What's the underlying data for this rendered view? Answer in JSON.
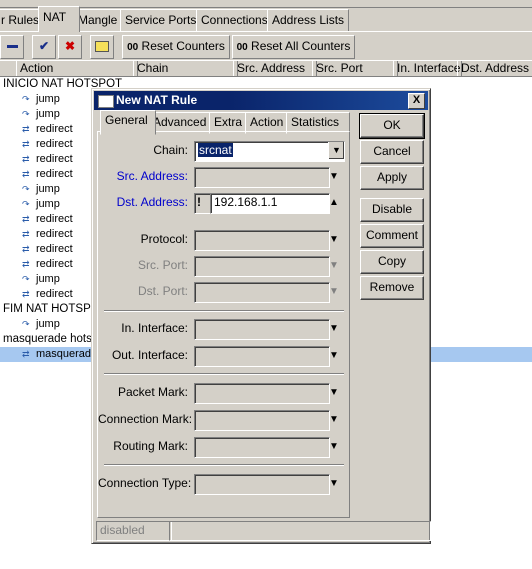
{
  "tabs": [
    "r Rules",
    "NAT",
    "Mangle",
    "Service Ports",
    "Connections",
    "Address Lists"
  ],
  "toolbar": {
    "reset_counters": "Reset Counters",
    "reset_all_counters": "Reset All Counters",
    "counter_icon": "00"
  },
  "columns": [
    "Action",
    "Chain",
    "Src. Address",
    "Src. Port",
    "In. Interface",
    "Dst. Address"
  ],
  "rows": [
    {
      "text": "INICIO NAT HOTSPOT",
      "kind": "comment"
    },
    {
      "text": "jump",
      "kind": "jump"
    },
    {
      "text": "jump",
      "kind": "jump"
    },
    {
      "text": "redirect",
      "kind": "redirect"
    },
    {
      "text": "redirect",
      "kind": "redirect"
    },
    {
      "text": "redirect",
      "kind": "redirect"
    },
    {
      "text": "redirect",
      "kind": "redirect"
    },
    {
      "text": "jump",
      "kind": "jump"
    },
    {
      "text": "jump",
      "kind": "jump"
    },
    {
      "text": "redirect",
      "kind": "redirect"
    },
    {
      "text": "redirect",
      "kind": "redirect"
    },
    {
      "text": "redirect",
      "kind": "redirect"
    },
    {
      "text": "redirect",
      "kind": "redirect"
    },
    {
      "text": "jump",
      "kind": "jump"
    },
    {
      "text": "redirect",
      "kind": "redirect"
    },
    {
      "text": "FIM NAT HOTSPO",
      "kind": "comment"
    },
    {
      "text": "jump",
      "kind": "jump"
    },
    {
      "text": "masquerade hotsp",
      "kind": "comment"
    },
    {
      "text": "masquerade",
      "kind": "redirect",
      "selected": true
    }
  ],
  "dialog": {
    "title": "New NAT Rule",
    "tabs": [
      "General",
      "Advanced",
      "Extra",
      "Action",
      "Statistics"
    ],
    "fields": {
      "chain_label": "Chain:",
      "chain_value": "srcnat",
      "src_address_label": "Src. Address:",
      "dst_address_label": "Dst. Address:",
      "dst_address_value": "192.168.1.1",
      "dst_not": "!",
      "protocol_label": "Protocol:",
      "src_port_label": "Src. Port:",
      "dst_port_label": "Dst. Port:",
      "in_interface_label": "In. Interface:",
      "out_interface_label": "Out. Interface:",
      "packet_mark_label": "Packet Mark:",
      "connection_mark_label": "Connection Mark:",
      "routing_mark_label": "Routing Mark:",
      "connection_type_label": "Connection Type:"
    },
    "buttons": [
      "OK",
      "Cancel",
      "Apply",
      "Disable",
      "Comment",
      "Copy",
      "Remove"
    ],
    "status": "disabled",
    "close_glyph": "X"
  },
  "colors": {
    "title_bar": "#0a246a",
    "selected_row": "#a6c8f0",
    "blue_label": "#0000cc",
    "selection_highlight": "#0a246a"
  }
}
